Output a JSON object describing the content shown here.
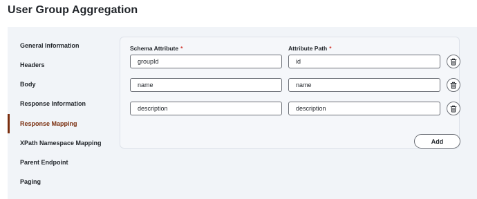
{
  "page": {
    "title": "User Group Aggregation"
  },
  "sidebar": {
    "items": [
      {
        "label": "General Information",
        "active": false
      },
      {
        "label": "Headers",
        "active": false
      },
      {
        "label": "Body",
        "active": false
      },
      {
        "label": "Response Information",
        "active": false
      },
      {
        "label": "Response Mapping",
        "active": true
      },
      {
        "label": "XPath Namespace Mapping",
        "active": false
      },
      {
        "label": "Parent Endpoint",
        "active": false
      },
      {
        "label": "Paging",
        "active": false
      }
    ]
  },
  "mapping": {
    "columns": {
      "schema_attribute": "Schema Attribute",
      "attribute_path": "Attribute Path",
      "required_marker": "*"
    },
    "rows": [
      {
        "schema_attribute": "groupId",
        "attribute_path": "id"
      },
      {
        "schema_attribute": "name",
        "attribute_path": "name"
      },
      {
        "schema_attribute": "description",
        "attribute_path": "description"
      }
    ],
    "add_label": "Add",
    "delete_icon": "trash-icon"
  },
  "colors": {
    "accent": "#7a2e0e",
    "required": "#d0352c",
    "panel_background": "#f1f4f8"
  }
}
